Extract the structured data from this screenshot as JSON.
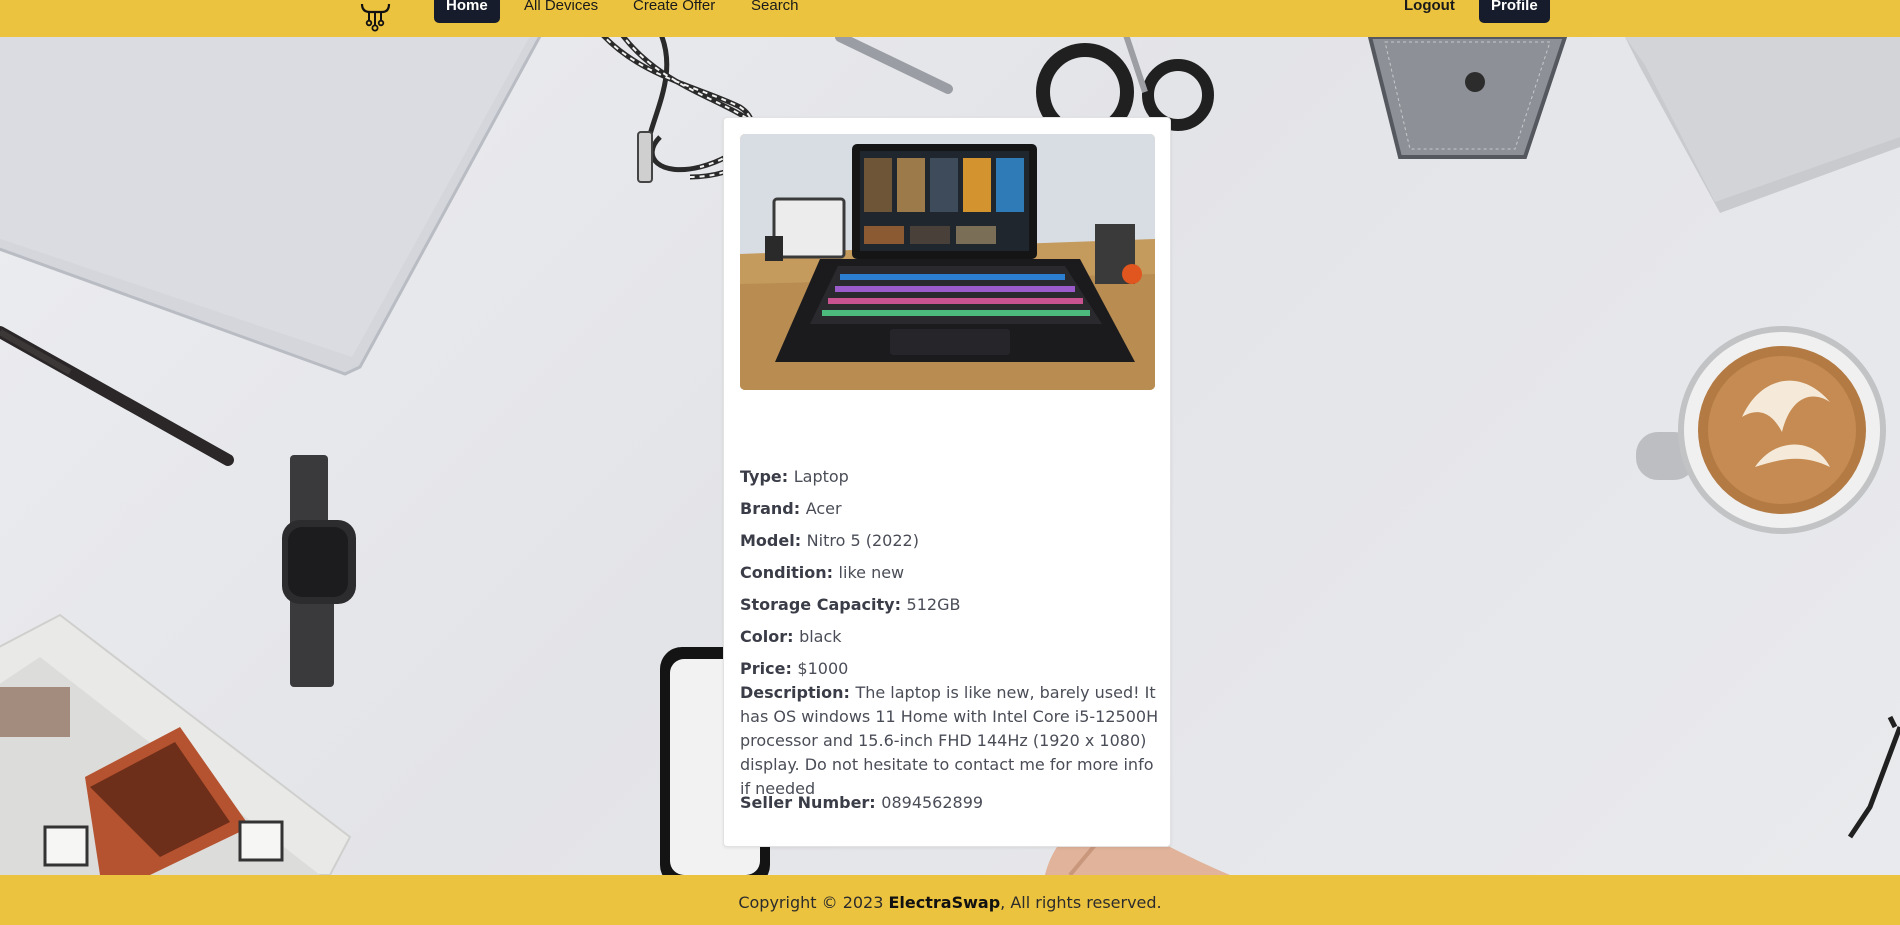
{
  "nav": {
    "home": "Home",
    "all_devices": "All Devices",
    "create_offer": "Create Offer",
    "search": "Search",
    "logout": "Logout",
    "profile": "Profile"
  },
  "device": {
    "image_icon": "laptop-photo",
    "specs": [
      {
        "label": "Type:",
        "value": "Laptop"
      },
      {
        "label": "Brand:",
        "value": "Acer"
      },
      {
        "label": "Model:",
        "value": "Nitro 5 (2022)"
      },
      {
        "label": "Condition:",
        "value": "like new"
      },
      {
        "label": "Storage Capacity:",
        "value": "512GB"
      },
      {
        "label": "Color:",
        "value": "black"
      },
      {
        "label": "Price:",
        "value": "$1000"
      }
    ],
    "description_label": "Description:",
    "description": "The laptop is like new, barely used! It has OS windows 11 Home with Intel Core i5-12500H processor and 15.6-inch FHD 144Hz (1920 x 1080) display. Do not hesitate to contact me for more info if needed",
    "seller_label": "Seller Number:",
    "seller_value": "0894562899"
  },
  "footer": {
    "prefix": "Copyright © 2023 ",
    "brand": "ElectraSwap",
    "suffix": ", All rights reserved."
  },
  "colors": {
    "accent": "#ecc33f",
    "dark_pill": "#161c2b"
  }
}
